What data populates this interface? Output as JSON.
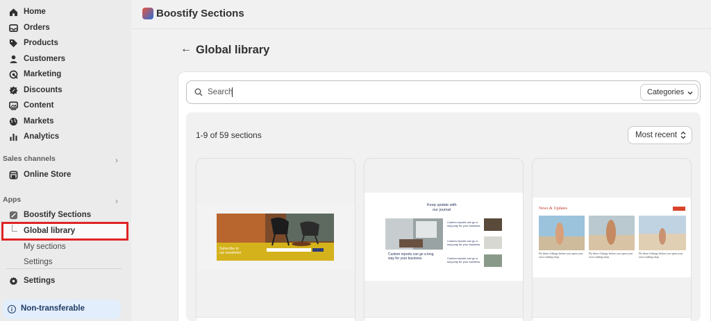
{
  "sidebar": {
    "items": [
      {
        "label": "Home",
        "icon": "home-icon"
      },
      {
        "label": "Orders",
        "icon": "inbox-icon"
      },
      {
        "label": "Products",
        "icon": "tag-icon"
      },
      {
        "label": "Customers",
        "icon": "person-icon"
      },
      {
        "label": "Marketing",
        "icon": "target-icon"
      },
      {
        "label": "Discounts",
        "icon": "discount-icon"
      },
      {
        "label": "Content",
        "icon": "image-icon"
      },
      {
        "label": "Markets",
        "icon": "globe-icon"
      },
      {
        "label": "Analytics",
        "icon": "bar-chart-icon"
      }
    ],
    "sales_channels": {
      "heading": "Sales channels",
      "online_store": "Online Store"
    },
    "apps": {
      "heading": "Apps",
      "boostify": "Boostify Sections",
      "global_library": "Global library",
      "my_sections": "My sections",
      "settings": "Settings"
    },
    "settings": "Settings",
    "non_transferable": "Non-transferable"
  },
  "header": {
    "app_title": "Boostify Sections"
  },
  "page": {
    "title": "Global library"
  },
  "search": {
    "placeholder": "Search"
  },
  "categories_label": "Categories",
  "results_count": "1-9 of 59 sections",
  "sort_label": "Most recent",
  "previews": {
    "newsletter": {
      "line1": "Subscribe to",
      "line2": "our newsletter"
    },
    "journal": {
      "title_line1": "Keep update with",
      "title_line2": "our journal",
      "feature": "Custom reports can go a long way for your business",
      "items": [
        "Custom reports can go a long way for your business",
        "Custom reports can go a long way for your business",
        "Custom reports can go a long way for your business"
      ]
    },
    "news": {
      "title": "News & Updates",
      "caption": "Do these 4 things before you open your own crafting shop"
    }
  },
  "colors": {
    "highlight": "#e02424",
    "accent": "#c0392b"
  }
}
